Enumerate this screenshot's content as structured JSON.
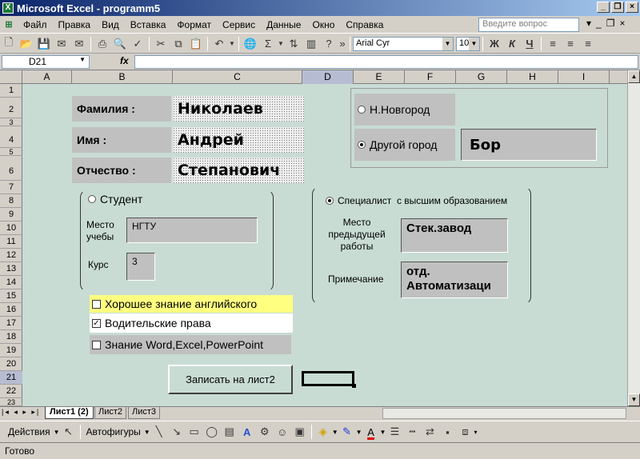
{
  "window": {
    "title": "Microsoft Excel - programm5",
    "app_icon": "excel-icon"
  },
  "menu": [
    "Файл",
    "Правка",
    "Вид",
    "Вставка",
    "Формат",
    "Сервис",
    "Данные",
    "Окно",
    "Справка"
  ],
  "ask_placeholder": "Введите вопрос",
  "format": {
    "font": "Arial Cyr",
    "size": "10",
    "bold": "Ж",
    "italic": "К",
    "underline": "Ч"
  },
  "formula": {
    "namebox": "D21",
    "fx": "fx",
    "value": ""
  },
  "columns": [
    "A",
    "B",
    "C",
    "D",
    "E",
    "F",
    "G",
    "H",
    "I"
  ],
  "selected_column": "D",
  "rows": [
    "1",
    "2",
    "3",
    "4",
    "5",
    "6",
    "7",
    "8",
    "9",
    "10",
    "11",
    "12",
    "13",
    "14",
    "15",
    "16",
    "17",
    "18",
    "19",
    "20",
    "21",
    "22",
    "23"
  ],
  "selected_row": "21",
  "form": {
    "surname_label": "Фамилия :",
    "surname_value": "Николаев",
    "name_label": "Имя :",
    "name_value": "Андрей",
    "patronymic_label": "Отчество :",
    "patronymic_value": "Степанович",
    "city_option1": "Н.Новгород",
    "city_option2": "Другой город",
    "city_value": "Бор",
    "student_option": "Студент",
    "study_place_label": "Место учебы",
    "study_place_value": "НГТУ",
    "course_label": "Курс",
    "course_value": "3",
    "specialist_option": "Специалист  с высшим образованием",
    "prev_work_label": "Место предыдущей работы",
    "prev_work_value": "Стек.завод",
    "note_label": "Примечание",
    "note_value": "отд. Автоматизаци",
    "check1": "Хорошее знание английского",
    "check2": "Водительские права",
    "check3": "Знание Word,Excel,PowerPoint",
    "submit_button": "Записать на лист2"
  },
  "sheet_tabs": [
    "Лист1 (2)",
    "Лист2",
    "Лист3"
  ],
  "draw_bar": {
    "actions": "Действия",
    "autoshapes": "Автофигуры"
  },
  "status": "Готово",
  "colors": {
    "title_start": "#0a246a",
    "title_end": "#a6caf0",
    "grid_bg": "#c8dcd4",
    "highlight_yellow": "#ffff80"
  }
}
